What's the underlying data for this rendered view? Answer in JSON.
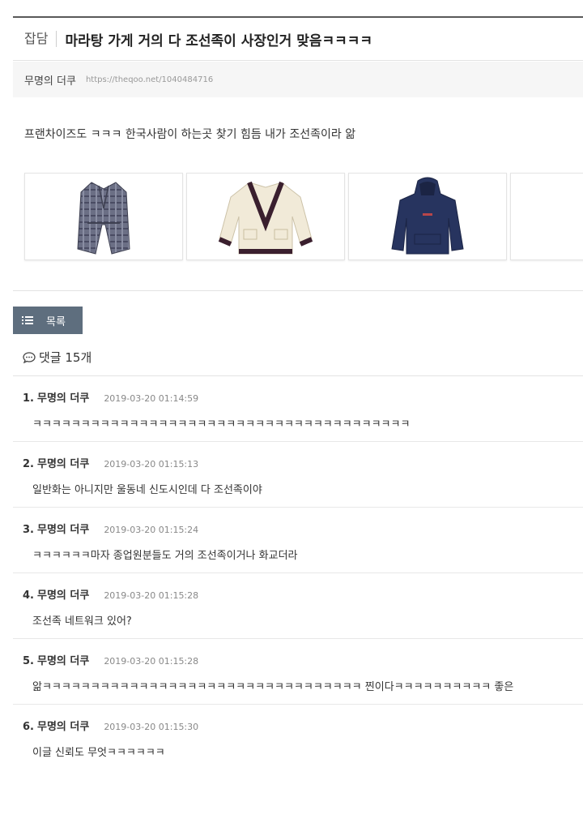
{
  "post": {
    "category": "잡담",
    "title": "마라탕 가게 거의 다 조선족이 사장인거 맞음ㅋㅋㅋㅋ",
    "author": "무명의 더쿠",
    "url": "https://theqoo.net/1040484716",
    "body": "프랜차이즈도 ㅋㅋㅋ 한국사람이 하는곳 찾기 힘듬 내가 조선족이라 앎"
  },
  "products": [
    {
      "icon": "plaid-jacket-image"
    },
    {
      "icon": "cream-cardigan-image"
    },
    {
      "icon": "navy-hoodie-image"
    },
    {
      "icon": "beige-phone-case-image"
    }
  ],
  "list_button": {
    "label": "목록",
    "icon": "list-icon",
    "color": "#5e6e7e"
  },
  "comments_header": {
    "label": "댓글 15개",
    "icon": "speech-bubble-icon"
  },
  "comments": [
    {
      "num": "1.",
      "name": "무명의 더쿠",
      "time": "2019-03-20 01:14:59",
      "text": "ㅋㅋㅋㅋㅋㅋㅋㅋㅋㅋㅋㅋㅋㅋㅋㅋㅋㅋㅋㅋㅋㅋㅋㅋㅋㅋㅋㅋㅋㅋㅋㅋㅋㅋㅋㅋㅋㅋㅋ"
    },
    {
      "num": "2.",
      "name": "무명의 더쿠",
      "time": "2019-03-20 01:15:13",
      "text": "일반화는 아니지만 울동네 신도시인데 다 조선족이야"
    },
    {
      "num": "3.",
      "name": "무명의 더쿠",
      "time": "2019-03-20 01:15:24",
      "text": "ㅋㅋㅋㅋㅋㅋ마자 종업원분들도 거의 조선족이거나 화교더라"
    },
    {
      "num": "4.",
      "name": "무명의 더쿠",
      "time": "2019-03-20 01:15:28",
      "text": "조선족 네트워크 있어?"
    },
    {
      "num": "5.",
      "name": "무명의 더쿠",
      "time": "2019-03-20 01:15:28",
      "text": "앎ㅋㅋㅋㅋㅋㅋㅋㅋㅋㅋㅋㅋㅋㅋㅋㅋㅋㅋㅋㅋㅋㅋㅋㅋㅋㅋㅋㅋㅋㅋㅋㅋㅋ 찐이다ㅋㅋㅋㅋㅋㅋㅋㅋㅋㅋ 좋은"
    },
    {
      "num": "6.",
      "name": "무명의 더쿠",
      "time": "2019-03-20 01:15:30",
      "text": "이글 신뢰도 무엇ㅋㅋㅋㅋㅋㅋ"
    }
  ]
}
